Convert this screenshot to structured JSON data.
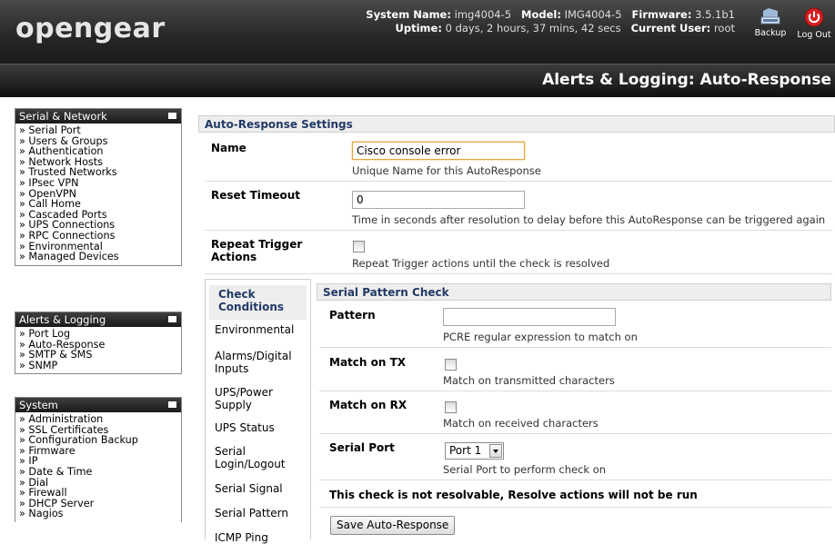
{
  "header": {
    "logo": "opengear",
    "system_name_label": "System Name:",
    "system_name": "img4004-5",
    "model_label": "Model:",
    "model": "IMG4004-5",
    "firmware_label": "Firmware:",
    "firmware": "3.5.1b1",
    "uptime_label": "Uptime:",
    "uptime": "0 days, 2 hours, 37 mins, 42 secs",
    "user_label": "Current User:",
    "user": "root",
    "backup_label": "Backup",
    "logout_label": "Log Out"
  },
  "page_title": "Alerts & Logging: Auto-Response",
  "sidebar": {
    "serial_network": {
      "title": "Serial & Network",
      "items": [
        "» Serial Port",
        "» Users & Groups",
        "» Authentication",
        "» Network Hosts",
        "» Trusted Networks",
        "» IPsec VPN",
        "» OpenVPN",
        "» Call Home",
        "» Cascaded Ports",
        "» UPS Connections",
        "» RPC Connections",
        "» Environmental",
        "» Managed Devices"
      ]
    },
    "alerts_logging": {
      "title": "Alerts & Logging",
      "items": [
        "» Port Log",
        "» Auto-Response",
        "» SMTP & SMS",
        "» SNMP"
      ]
    },
    "system": {
      "title": "System",
      "items": [
        "» Administration",
        "» SSL Certificates",
        "» Configuration Backup",
        "» Firmware",
        "» IP",
        "» Date & Time",
        "» Dial",
        "» Firewall",
        "» DHCP Server",
        "» Nagios"
      ]
    }
  },
  "settings": {
    "section_title": "Auto-Response Settings",
    "name_label": "Name",
    "name_value": "Cisco console error",
    "name_hint": "Unique Name for this AutoResponse",
    "reset_label": "Reset Timeout",
    "reset_value": "0",
    "reset_hint": "Time in seconds after resolution to delay before this AutoResponse can be triggered again",
    "repeat_label_1": "Repeat Trigger",
    "repeat_label_2": "Actions",
    "repeat_hint": "Repeat Trigger actions until the check is resolved"
  },
  "tabs": {
    "active": "Check Conditions",
    "items": [
      "Environmental",
      "Alarms/Digital Inputs",
      "UPS/Power Supply",
      "UPS Status",
      "Serial Login/Logout",
      "Serial Signal",
      "Serial Pattern",
      "ICMP Ping"
    ]
  },
  "check": {
    "section_title": "Serial Pattern Check",
    "pattern_label": "Pattern",
    "pattern_value": "",
    "pattern_hint": "PCRE regular expression to match on",
    "tx_label": "Match on TX",
    "tx_hint": "Match on transmitted characters",
    "rx_label": "Match on RX",
    "rx_hint": "Match on received characters",
    "port_label": "Serial Port",
    "port_value": "Port 1",
    "port_hint": "Serial Port to perform check on",
    "note": "This check is not resolvable, Resolve actions will not be run",
    "save_label": "Save Auto-Response"
  }
}
